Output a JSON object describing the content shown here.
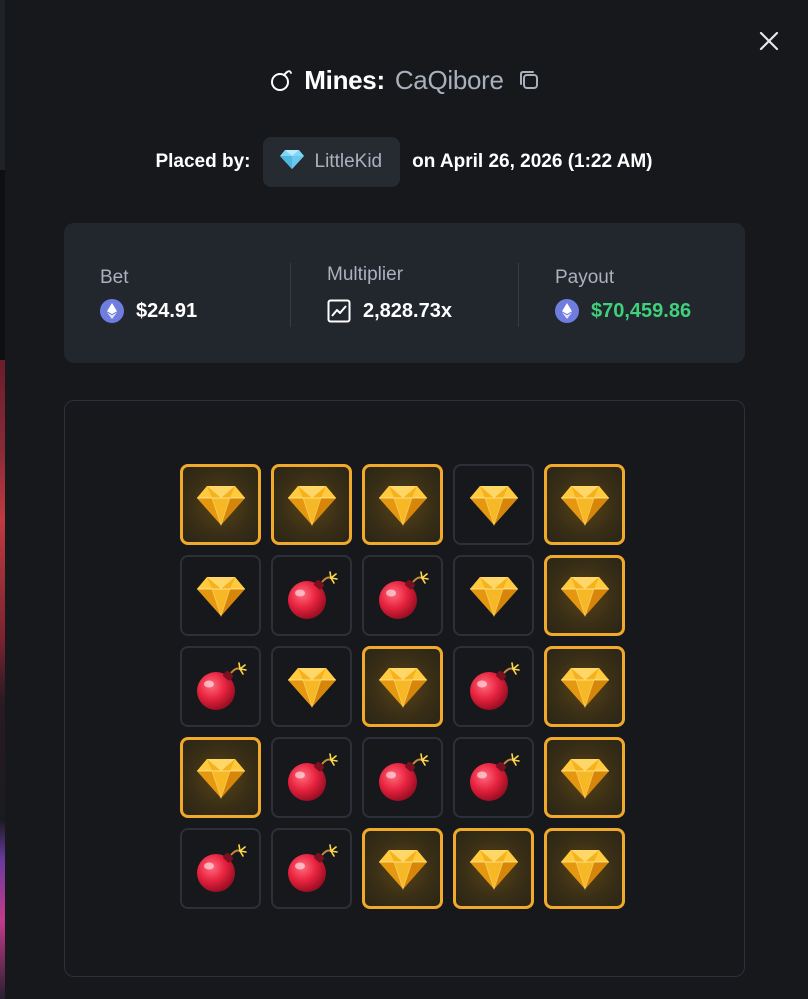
{
  "modal": {
    "game_name": "Mines:",
    "seed": "CaQibore",
    "placed_by_label": "Placed by:",
    "player_name": "LittleKid",
    "date_text": "on April 26, 2026 (1:22 AM)"
  },
  "stats": {
    "bet_label": "Bet",
    "bet_value": "$24.91",
    "multiplier_label": "Multiplier",
    "multiplier_value": "2,828.73x",
    "payout_label": "Payout",
    "payout_value": "$70,459.86",
    "payout_color": "#3fd07a"
  },
  "board": {
    "rows": [
      [
        {
          "type": "gem",
          "picked": true
        },
        {
          "type": "gem",
          "picked": true
        },
        {
          "type": "gem",
          "picked": true
        },
        {
          "type": "gem",
          "picked": false
        },
        {
          "type": "gem",
          "picked": true
        }
      ],
      [
        {
          "type": "gem",
          "picked": false
        },
        {
          "type": "mine",
          "picked": false
        },
        {
          "type": "mine",
          "picked": false
        },
        {
          "type": "gem",
          "picked": false
        },
        {
          "type": "gem",
          "picked": true
        }
      ],
      [
        {
          "type": "mine",
          "picked": false
        },
        {
          "type": "gem",
          "picked": false
        },
        {
          "type": "gem",
          "picked": true
        },
        {
          "type": "mine",
          "picked": false
        },
        {
          "type": "gem",
          "picked": true
        }
      ],
      [
        {
          "type": "gem",
          "picked": true
        },
        {
          "type": "mine",
          "picked": false
        },
        {
          "type": "mine",
          "picked": false
        },
        {
          "type": "mine",
          "picked": false
        },
        {
          "type": "gem",
          "picked": true
        }
      ],
      [
        {
          "type": "mine",
          "picked": false
        },
        {
          "type": "mine",
          "picked": false
        },
        {
          "type": "gem",
          "picked": true
        },
        {
          "type": "gem",
          "picked": true
        },
        {
          "type": "gem",
          "picked": true
        }
      ]
    ],
    "picked_border_color": "#f0a92a",
    "gem_color": "#f6b11c",
    "mine_color": "#e8233f"
  },
  "icons": {
    "close": "close-icon",
    "title": "bomb-outline-icon",
    "copy": "copy-icon",
    "player_badge": "diamond-icon",
    "currency": "ethereum-icon",
    "multiplier": "chart-line-icon"
  }
}
